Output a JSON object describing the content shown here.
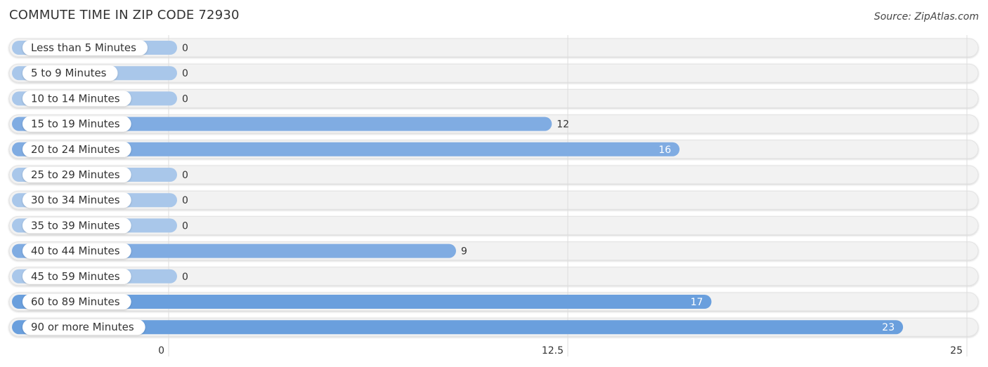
{
  "title": "COMMUTE TIME IN ZIP CODE 72930",
  "source": "Source: ZipAtlas.com",
  "colors": {
    "bar_light": "#a9c7ea",
    "bar_mid": "#80ace2",
    "bar_dark": "#6a9fdd",
    "track": "#f2f2f2",
    "grid": "#dddddd"
  },
  "chart_data": {
    "type": "bar",
    "orientation": "horizontal",
    "title": "COMMUTE TIME IN ZIP CODE 72930",
    "xlabel": "",
    "ylabel": "",
    "categories": [
      "Less than 5 Minutes",
      "5 to 9 Minutes",
      "10 to 14 Minutes",
      "15 to 19 Minutes",
      "20 to 24 Minutes",
      "25 to 29 Minutes",
      "30 to 34 Minutes",
      "35 to 39 Minutes",
      "40 to 44 Minutes",
      "45 to 59 Minutes",
      "60 to 89 Minutes",
      "90 or more Minutes"
    ],
    "values": [
      0,
      0,
      0,
      12,
      16,
      0,
      0,
      0,
      9,
      0,
      17,
      23
    ],
    "xlim": [
      0,
      25
    ],
    "xticks": [
      0,
      12.5,
      25
    ],
    "xtick_labels": [
      "0",
      "12.5",
      "25"
    ],
    "grid": true
  }
}
